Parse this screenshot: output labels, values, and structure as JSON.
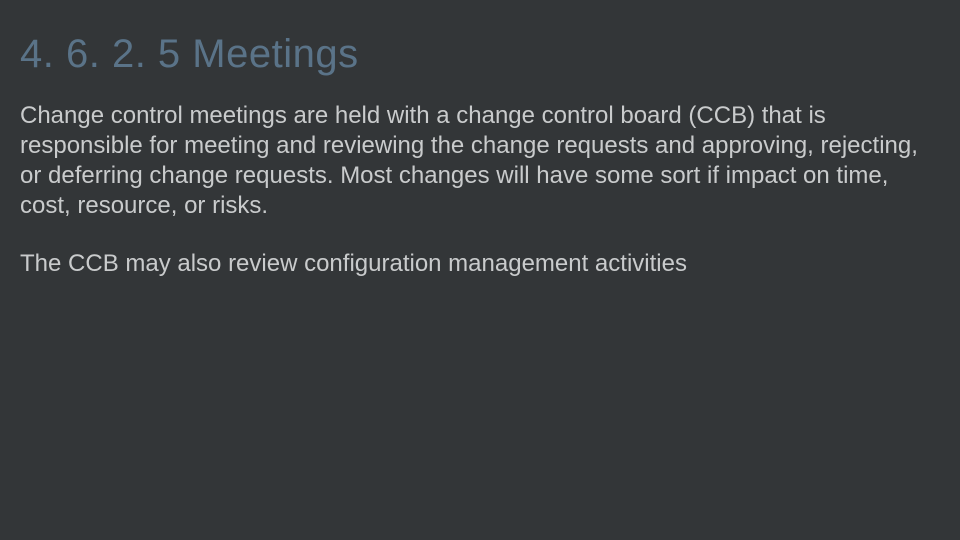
{
  "slide": {
    "title": "4. 6. 2. 5 Meetings",
    "paragraphs": [
      "Change control meetings are held with a change control board (CCB) that is responsible for meeting and reviewing the change requests and approving, rejecting, or deferring change requests. Most changes will have some sort if impact on time, cost, resource, or risks.",
      "The CCB may also review configuration management activities"
    ]
  }
}
